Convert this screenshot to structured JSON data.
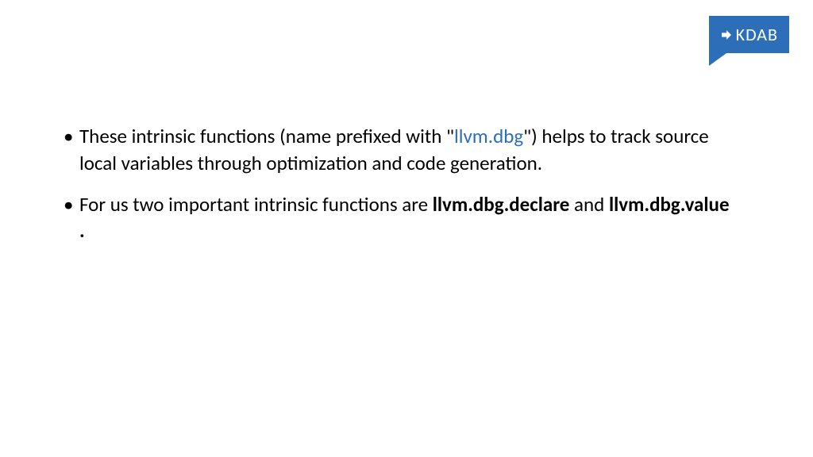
{
  "logo": {
    "text": "KDAB"
  },
  "bullets": {
    "b1": {
      "t1": "These intrinsic functions (name prefixed with \"",
      "link": "llvm.dbg",
      "t2": "\") helps to track source local variables through optimization and code generation."
    },
    "b2": {
      "t1": "For us two important intrinsic functions are ",
      "bold1": "llvm.dbg.declare",
      "t2": " and ",
      "bold2": "llvm.dbg.value .",
      "t3": ""
    }
  }
}
